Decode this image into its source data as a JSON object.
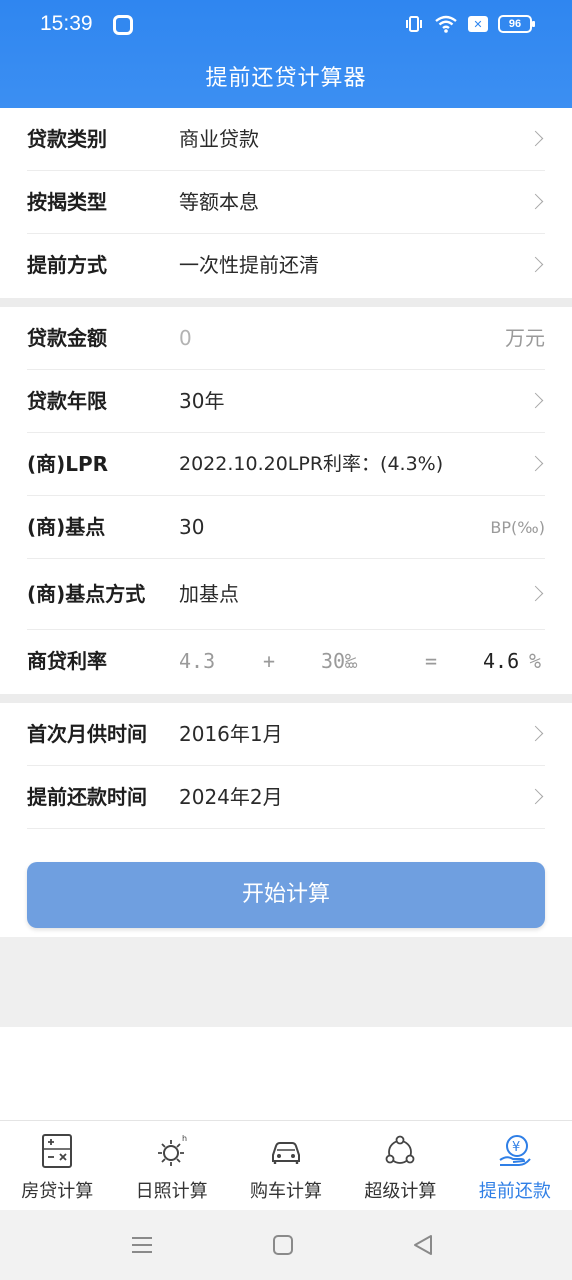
{
  "status": {
    "time": "15:39",
    "battery": "96"
  },
  "header": {
    "title": "提前还贷计算器"
  },
  "group1": [
    {
      "label": "贷款类别",
      "value": "商业贷款"
    },
    {
      "label": "按揭类型",
      "value": "等额本息"
    },
    {
      "label": "提前方式",
      "value": "一次性提前还清"
    }
  ],
  "group2": {
    "amount": {
      "label": "贷款金额",
      "placeholder": "0",
      "unit": "万元"
    },
    "years": {
      "label": "贷款年限",
      "value": "30年"
    },
    "lpr": {
      "label": "(商)LPR",
      "value": "2022.10.20LPR利率：(4.3%)"
    },
    "basis": {
      "label": "(商)基点",
      "value": "30",
      "unit": "BP(‰)"
    },
    "basis_mode": {
      "label": "(商)基点方式",
      "value": "加基点"
    },
    "rate": {
      "label": "商贷利率",
      "base": "4.3",
      "plus": "+",
      "points": "30‱",
      "equals": "=",
      "result": "4.6",
      "unit": "%"
    }
  },
  "group3": [
    {
      "label": "首次月供时间",
      "value": "2016年1月"
    },
    {
      "label": "提前还款时间",
      "value": "2024年2月"
    }
  ],
  "button": {
    "label": "开始计算"
  },
  "tabs": [
    {
      "label": "房贷计算",
      "icon": "calculator-icon"
    },
    {
      "label": "日照计算",
      "icon": "sun-icon"
    },
    {
      "label": "购车计算",
      "icon": "car-icon"
    },
    {
      "label": "超级计算",
      "icon": "network-icon"
    },
    {
      "label": "提前还款",
      "icon": "yuan-hand-icon"
    }
  ],
  "colors": {
    "primary": "#2f86f0",
    "button": "#6f9fe0",
    "active_tab": "#2f7fe6"
  }
}
